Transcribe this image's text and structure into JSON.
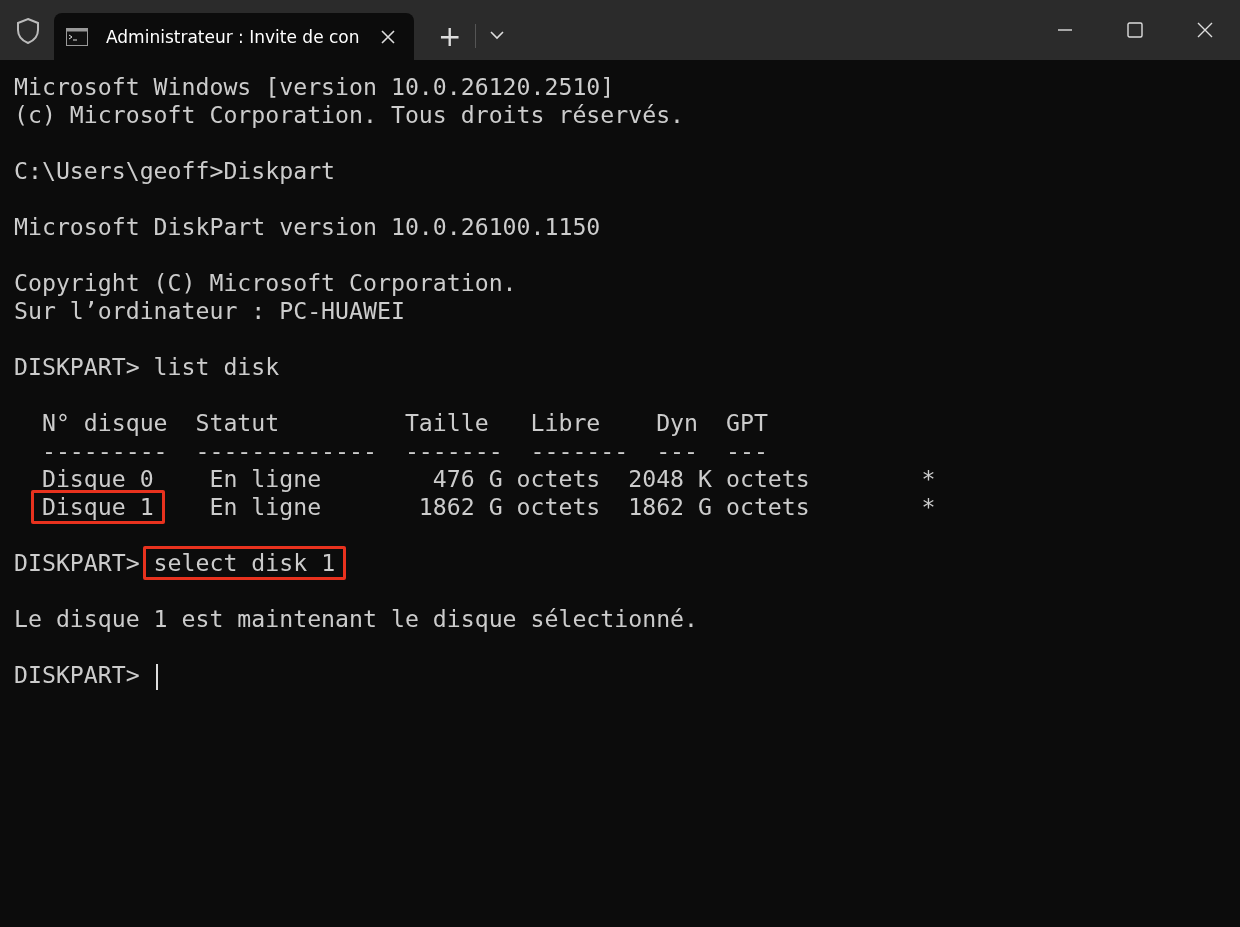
{
  "tab": {
    "title": "Administrateur : Invite de con",
    "selected": true
  },
  "new_tab": {
    "label": "+"
  },
  "terminal": {
    "lines": [
      {
        "kind": "text",
        "text": "Microsoft Windows [version 10.0.26120.2510]"
      },
      {
        "kind": "text",
        "text": "(c) Microsoft Corporation. Tous droits réservés."
      },
      {
        "kind": "blank"
      },
      {
        "kind": "text",
        "text": "C:\\Users\\geoff>Diskpart"
      },
      {
        "kind": "blank"
      },
      {
        "kind": "text",
        "text": "Microsoft DiskPart version 10.0.26100.1150"
      },
      {
        "kind": "blank"
      },
      {
        "kind": "text",
        "text": "Copyright (C) Microsoft Corporation."
      },
      {
        "kind": "text",
        "text": "Sur l’ordinateur : PC-HUAWEI"
      },
      {
        "kind": "blank"
      },
      {
        "kind": "text",
        "text": "DISKPART> list disk"
      },
      {
        "kind": "blank"
      },
      {
        "kind": "text",
        "text": "  N° disque  Statut         Taille   Libre    Dyn  GPT"
      },
      {
        "kind": "text",
        "text": "  ---------  -------------  -------  -------  ---  ---"
      },
      {
        "kind": "text",
        "text": "  Disque 0    En ligne        476 G octets  2048 K octets        *"
      },
      {
        "kind": "marked",
        "indented": true,
        "mark": "Disque 1",
        "after": "    En ligne       1862 G octets  1862 G octets        *"
      },
      {
        "kind": "blank"
      },
      {
        "kind": "marked",
        "indented": false,
        "before": "DISKPART> ",
        "mark": "select disk 1"
      },
      {
        "kind": "blank"
      },
      {
        "kind": "text",
        "text": "Le disque 1 est maintenant le disque sélectionné."
      },
      {
        "kind": "blank"
      },
      {
        "kind": "prompt",
        "text": "DISKPART> "
      }
    ]
  }
}
